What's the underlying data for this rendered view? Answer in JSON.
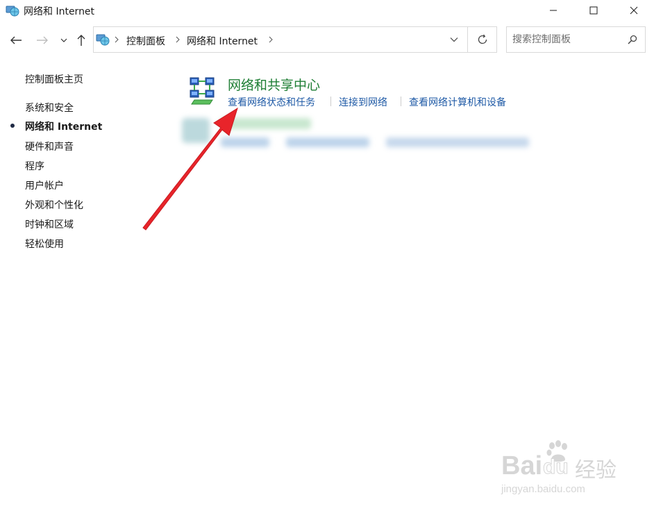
{
  "window": {
    "title": "网络和 Internet",
    "icon": "network-globe-icon"
  },
  "address_bar": {
    "crumbs": [
      "控制面板",
      "网络和 Internet"
    ]
  },
  "search": {
    "placeholder": "搜索控制面板"
  },
  "sidebar": {
    "home_label": "控制面板主页",
    "items": [
      {
        "label": "系统和安全",
        "active": false
      },
      {
        "label": "网络和 Internet",
        "active": true
      },
      {
        "label": "硬件和声音",
        "active": false
      },
      {
        "label": "程序",
        "active": false
      },
      {
        "label": "用户帐户",
        "active": false
      },
      {
        "label": "外观和个性化",
        "active": false
      },
      {
        "label": "时钟和区域",
        "active": false
      },
      {
        "label": "轻松使用",
        "active": false
      }
    ]
  },
  "main": {
    "category": {
      "title": "网络和共享中心",
      "icon": "network-sharing-center-icon",
      "links": [
        "查看网络状态和任务",
        "连接到网络",
        "查看网络计算机和设备"
      ]
    }
  },
  "colors": {
    "category_title": "#1e7e34",
    "link": "#1f5aa6",
    "annotation_arrow": "#e8242a"
  },
  "watermark": {
    "brand": "Bai",
    "brand_du": "du",
    "cn": "经验",
    "url": "jingyan.baidu.com"
  }
}
